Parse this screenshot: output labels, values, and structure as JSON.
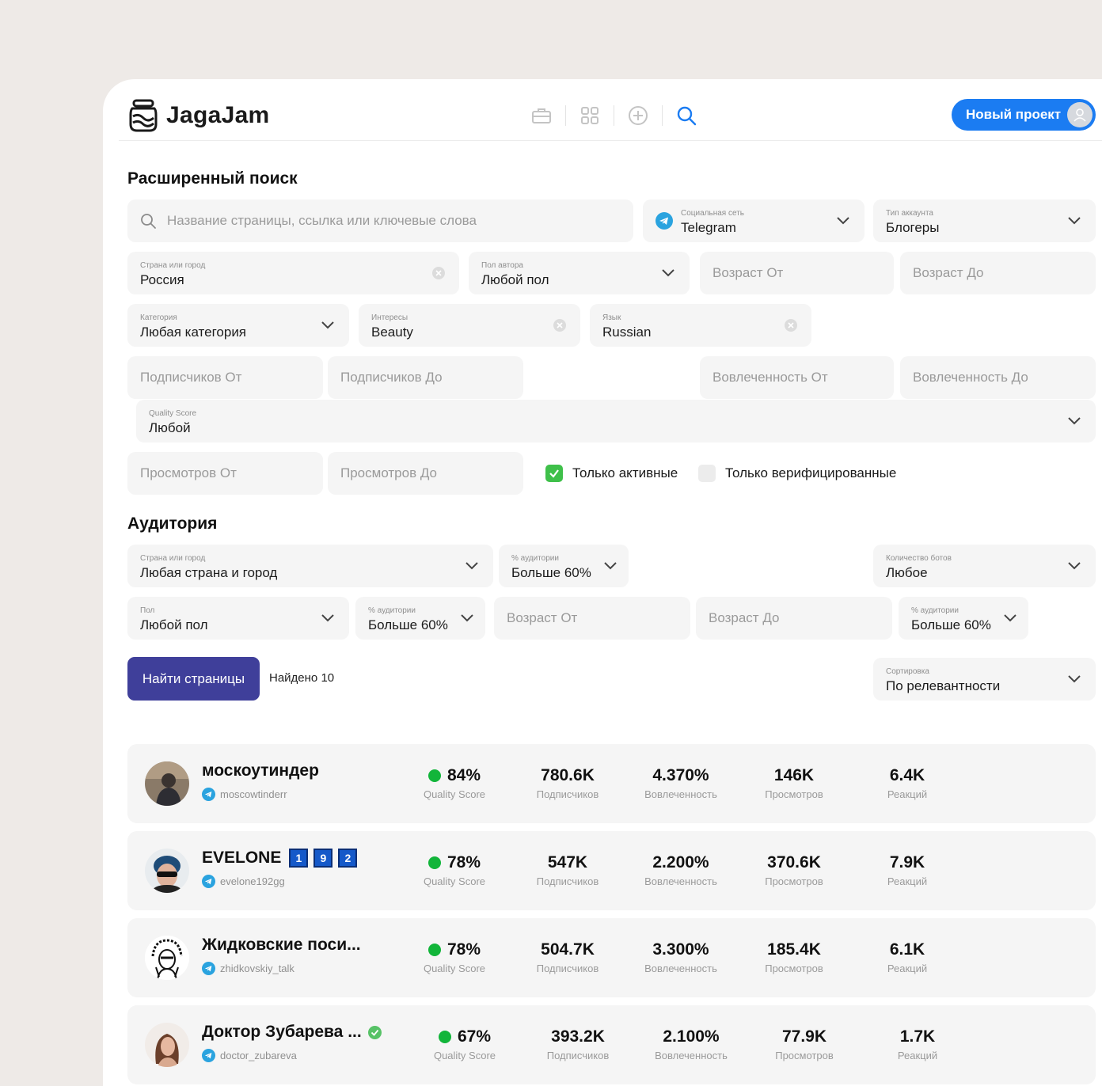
{
  "header": {
    "logo_text": "JagaJam",
    "new_project_label": "Новый проект",
    "nav": [
      "briefcase-icon",
      "grid-icon",
      "plus-circle-icon",
      "search-icon"
    ]
  },
  "search": {
    "title": "Расширенный поиск",
    "query_placeholder": "Название страницы, ссылка или ключевые слова",
    "social_network": {
      "label": "Социальная сеть",
      "value": "Telegram"
    },
    "account_type": {
      "label": "Тип аккаунта",
      "value": "Блогеры"
    },
    "country": {
      "label": "Страна или город",
      "value": "Россия"
    },
    "author_gender": {
      "label": "Пол автора",
      "value": "Любой пол"
    },
    "age_from_placeholder": "Возраст От",
    "age_to_placeholder": "Возраст До",
    "category": {
      "label": "Категория",
      "value": "Любая категория"
    },
    "interests": {
      "label": "Интересы",
      "value": "Beauty"
    },
    "language": {
      "label": "Язык",
      "value": "Russian"
    },
    "subs_from_placeholder": "Подписчиков От",
    "subs_to_placeholder": "Подписчиков До",
    "eng_from_placeholder": "Вовлеченность От",
    "eng_to_placeholder": "Вовлеченность До",
    "quality": {
      "label": "Quality Score",
      "value": "Любой"
    },
    "views_from_placeholder": "Просмотров От",
    "views_to_placeholder": "Просмотров До",
    "only_active": {
      "label": "Только активные",
      "checked": true
    },
    "only_verified": {
      "label": "Только верифицированные",
      "checked": false
    }
  },
  "audience": {
    "title": "Аудитория",
    "country": {
      "label": "Страна или город",
      "value": "Любая страна и город"
    },
    "country_pct": {
      "label": "% аудитории",
      "value": "Больше 60%"
    },
    "bots": {
      "label": "Количество ботов",
      "value": "Любое"
    },
    "gender": {
      "label": "Пол",
      "value": "Любой пол"
    },
    "gender_pct": {
      "label": "% аудитории",
      "value": "Больше 60%"
    },
    "age_from_placeholder": "Возраст От",
    "age_to_placeholder": "Возраст До",
    "age_pct": {
      "label": "% аудитории",
      "value": "Больше 60%"
    }
  },
  "actions": {
    "find_label": "Найти страницы",
    "found_text": "Найдено 10",
    "sort": {
      "label": "Сортировка",
      "value": "По релевантности"
    }
  },
  "stat_labels": {
    "quality": "Quality Score",
    "subs": "Подписчиков",
    "eng": "Вовлеченность",
    "views": "Просмотров",
    "reactions": "Реакций"
  },
  "results": [
    {
      "name": "москоутиндер",
      "handle": "moscowtinderr",
      "quality": "84%",
      "subs": "780.6K",
      "eng": "4.370%",
      "views": "146K",
      "reactions": "6.4K"
    },
    {
      "name": "EVELONE",
      "badges": [
        "1",
        "9",
        "2"
      ],
      "handle": "evelone192gg",
      "quality": "78%",
      "subs": "547K",
      "eng": "2.200%",
      "views": "370.6K",
      "reactions": "7.9K"
    },
    {
      "name": "Жидковские поси...",
      "handle": "zhidkovskiy_talk",
      "quality": "78%",
      "subs": "504.7K",
      "eng": "3.300%",
      "views": "185.4K",
      "reactions": "6.1K"
    },
    {
      "name": "Доктор Зубарева ...",
      "verified": true,
      "handle": "doctor_zubareva",
      "quality": "67%",
      "subs": "393.2K",
      "eng": "2.100%",
      "views": "77.9K",
      "reactions": "1.7K"
    }
  ]
}
